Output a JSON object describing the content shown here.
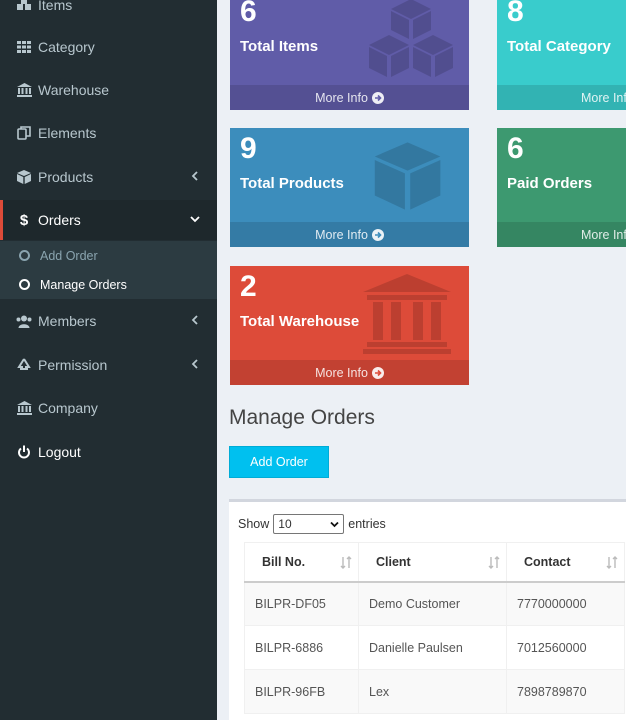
{
  "sidebar": {
    "items": [
      {
        "key": "items",
        "label": "Items",
        "icon": "cubes-icon"
      },
      {
        "key": "category",
        "label": "Category",
        "icon": "grid-icon"
      },
      {
        "key": "warehouse",
        "label": "Warehouse",
        "icon": "bank-icon"
      },
      {
        "key": "elements",
        "label": "Elements",
        "icon": "copy-icon"
      },
      {
        "key": "products",
        "label": "Products",
        "icon": "cube-icon"
      },
      {
        "key": "orders",
        "label": "Orders",
        "icon": "dollar-icon"
      },
      {
        "key": "members",
        "label": "Members",
        "icon": "users-icon"
      },
      {
        "key": "permission",
        "label": "Permission",
        "icon": "recycle-icon"
      },
      {
        "key": "company",
        "label": "Company",
        "icon": "bank-icon"
      },
      {
        "key": "logout",
        "label": "Logout",
        "icon": "power-icon"
      }
    ],
    "submenu": [
      {
        "label": "Add Order"
      },
      {
        "label": "Manage Orders"
      }
    ]
  },
  "stats": [
    {
      "value": "6",
      "label": "Total Items",
      "more": "More Info",
      "color": "#605ca8"
    },
    {
      "value": "8",
      "label": "Total Category",
      "more": "More Info",
      "color": "#39cccc"
    },
    {
      "value": "9",
      "label": "Total Products",
      "more": "More Info",
      "color": "#3c8dbc"
    },
    {
      "value": "6",
      "label": "Paid Orders",
      "more": "More Info",
      "color": "#3d9970"
    },
    {
      "value": "2",
      "label": "Total Warehouse",
      "more": "More Info",
      "color": "#dd4b39"
    }
  ],
  "main": {
    "title": "Manage Orders",
    "add_button": "Add Order"
  },
  "table": {
    "show_label": "Show",
    "page_size": "10",
    "entries_label": "entries",
    "columns": [
      "Bill No.",
      "Client",
      "Contact"
    ],
    "rows": [
      [
        "BILPR-DF05",
        "Demo Customer",
        "7770000000"
      ],
      [
        "BILPR-6886",
        "Danielle Paulsen",
        "7012560000"
      ],
      [
        "BILPR-96FB",
        "Lex",
        "7898789870"
      ]
    ]
  }
}
